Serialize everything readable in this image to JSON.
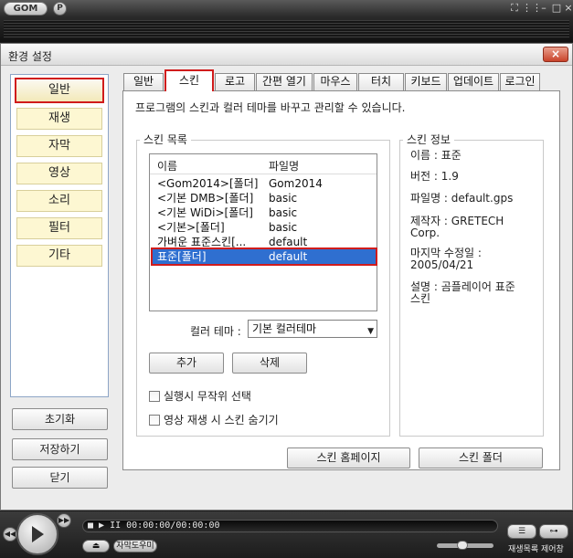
{
  "player": {
    "logo": "GOM",
    "plus": "P",
    "window_controls": [
      "⛶",
      "⋮⋮",
      "–",
      "□",
      "×"
    ],
    "time_display": "■ ▶ II  00:00:00/00:00:00",
    "subtitle_label": "자막도우미",
    "eject_symbol": "⏏",
    "playlist_label": "재생목록",
    "control_label": "제어창"
  },
  "dialog": {
    "title": "환경 설정",
    "close": "×"
  },
  "categories": [
    "일반",
    "재생",
    "자막",
    "영상",
    "소리",
    "필터",
    "기타"
  ],
  "side_buttons": {
    "reset": "초기화",
    "save": "저장하기",
    "close": "닫기"
  },
  "tabs": [
    "일반",
    "스킨",
    "로고",
    "간편 열기",
    "마우스",
    "터치",
    "키보드",
    "업데이트",
    "로그인"
  ],
  "skin_tab": {
    "description": "프로그램의 스킨과 컬러 테마를 바꾸고 관리할 수 있습니다.",
    "list_group_label": "스킨 목록",
    "col_name": "이름",
    "col_file": "파일명",
    "rows": [
      {
        "name": "<Gom2014>[폴더]",
        "file": "Gom2014"
      },
      {
        "name": "<기본 DMB>[폴더]",
        "file": "basic"
      },
      {
        "name": "<기본 WiDi>[폴더]",
        "file": "basic"
      },
      {
        "name": "<기본>[폴더]",
        "file": "basic"
      },
      {
        "name": "가벼운 표준스킨[...",
        "file": "default"
      },
      {
        "name": "표준[폴더]",
        "file": "default"
      }
    ],
    "color_theme_label": "컬러 테마 :",
    "color_theme_value": "기본 컬러테마",
    "add_button": "추가",
    "delete_button": "삭제",
    "random_on_start": "실행시 무작위 선택",
    "hide_on_play": "영상 재생 시 스킨 숨기기",
    "info_group_label": "스킨 정보",
    "info_name": "이름 : 표준",
    "info_version": "버전 : 1.9",
    "info_filename": "파일명 : default.gps",
    "info_author_1": "제작자 : GRETECH",
    "info_author_2": "Corp.",
    "info_modified_1": "마지막 수정일 :",
    "info_modified_2": "2005/04/21",
    "info_desc_1": "설명 : 곰플레이어 표준",
    "info_desc_2": "스킨",
    "homepage_button": "스킨 홈페이지",
    "folder_button": "스킨 폴더"
  }
}
